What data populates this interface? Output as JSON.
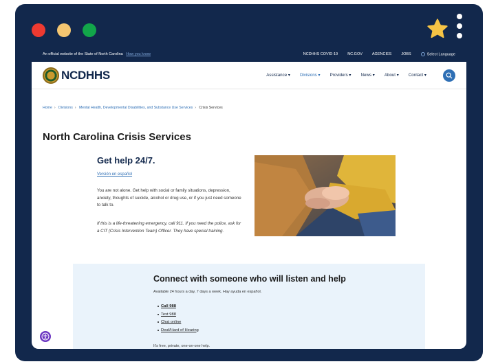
{
  "browser": {
    "star_icon": "star-icon",
    "menu_icon": "kebab-menu-icon"
  },
  "govbar": {
    "official": "An official website of the State of North Carolina",
    "how_you_know": "How you know",
    "links": [
      "NCDHHS COVID-19",
      "NC.GOV",
      "AGENCIES",
      "JOBS"
    ],
    "language": "Select Language"
  },
  "header": {
    "logo": "NCDHHS",
    "nav": [
      "Assistance",
      "Divisions",
      "Providers",
      "News",
      "About",
      "Contact"
    ]
  },
  "breadcrumb": [
    "Home",
    "Divisions",
    "Mental Health, Developmental Disabilities, and Substance Use Services",
    "Crisis Services"
  ],
  "page_title": "North Carolina Crisis Services",
  "help": {
    "title": "Get help 24/7.",
    "spanish_link": "Versión en español",
    "para1": "You are not alone. Get help with social or family situations, depression, anxiety, thoughts of suicide, alcohol or drug use, or if you just need someone to talk to.",
    "para2": "If this is a life-threatening emergency, call 911. If you need the police, ask for a CIT (Crisis Intervention Team) Officer. They have special training."
  },
  "connect": {
    "title": "Connect with someone who will listen and help",
    "available": "Available 24 hours a day, 7 days a week. Hay ayuda en español.",
    "options": [
      "Call 988",
      "Text 988",
      "Chat online",
      "Deaf/Hard of Hearing"
    ],
    "free": "It's free, private, one-on-one help."
  },
  "colors": {
    "frame": "#12284c",
    "accent": "#2e6fb5",
    "connect_bg": "#eaf3fb"
  }
}
